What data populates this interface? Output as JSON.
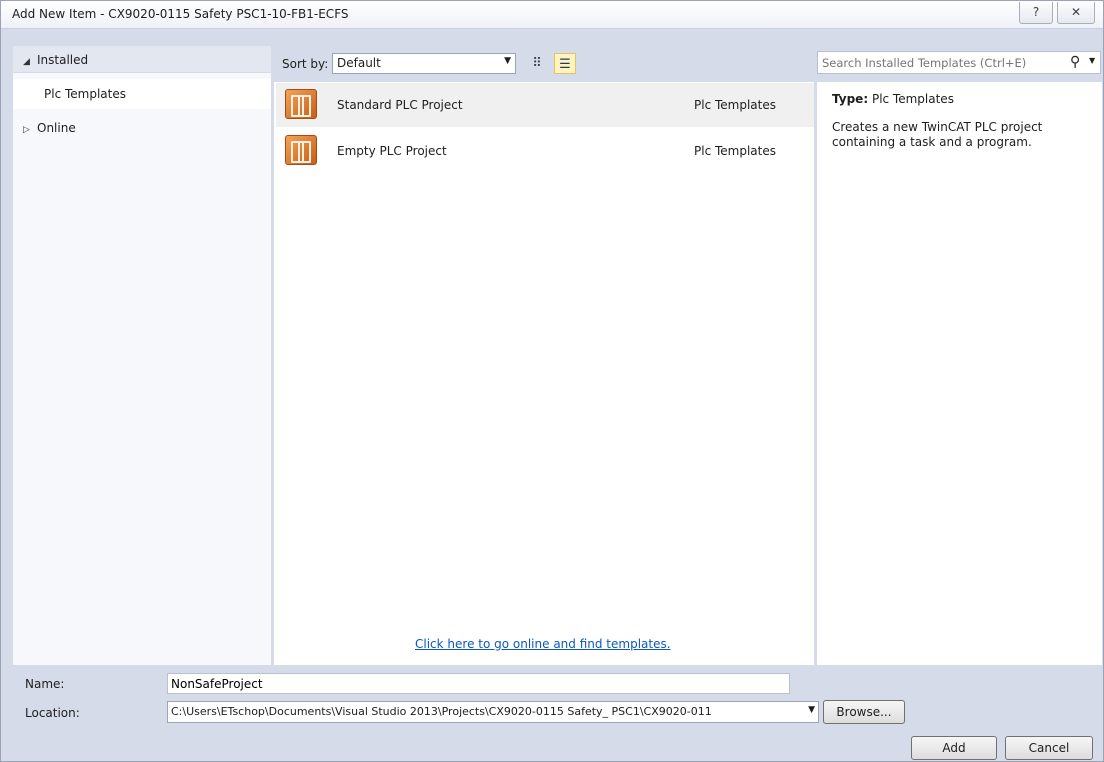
{
  "window": {
    "title": "Add New Item - CX9020-0115 Safety PSC1-10-FB1-ECFS",
    "help_glyph": "?",
    "close_glyph": "✕"
  },
  "tree": {
    "installed": {
      "arrow": "◢",
      "label": "Installed"
    },
    "plc_templates": {
      "label": "Plc Templates"
    },
    "online": {
      "arrow": "▷",
      "label": "Online"
    }
  },
  "sort": {
    "label": "Sort by:",
    "value": "Default"
  },
  "templates": [
    {
      "name": "Standard PLC Project",
      "category": "Plc Templates"
    },
    {
      "name": "Empty PLC Project",
      "category": "Plc Templates"
    }
  ],
  "online_link": "Click here to go online and find templates.",
  "search": {
    "placeholder": "Search Installed Templates (Ctrl+E)"
  },
  "details": {
    "type_label": "Type:",
    "type_value": "Plc Templates",
    "description": "Creates a new TwinCAT PLC project containing a task and a program."
  },
  "form": {
    "name_label": "Name:",
    "name_value": "NonSafeProject",
    "location_label": "Location:",
    "location_value": "C:\\Users\\ETschop\\Documents\\Visual Studio 2013\\Projects\\CX9020-0115 Safety_ PSC1\\CX9020-011"
  },
  "buttons": {
    "browse": "Browse...",
    "add": "Add",
    "cancel": "Cancel"
  }
}
